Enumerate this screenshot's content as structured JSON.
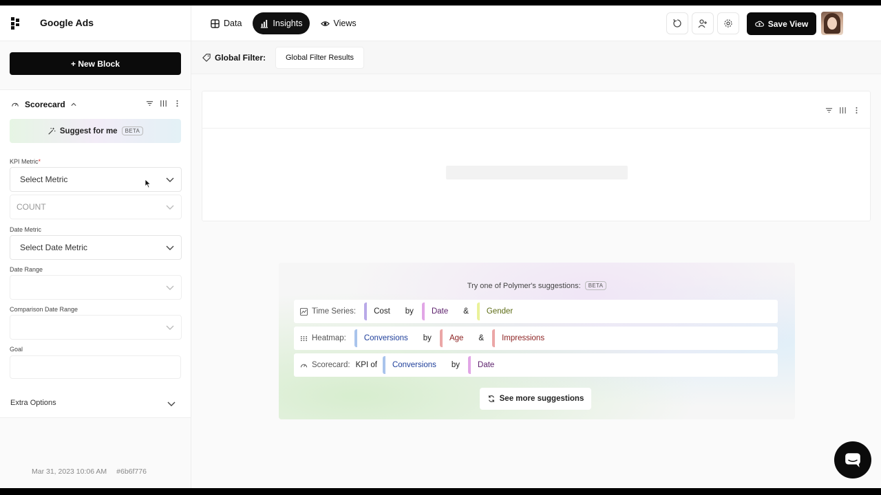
{
  "app": {
    "title": "Google Ads"
  },
  "nav": {
    "tabs": [
      {
        "label": "Data",
        "icon": "grid-icon",
        "active": false
      },
      {
        "label": "Insights",
        "icon": "bar-chart-icon",
        "active": true
      },
      {
        "label": "Views",
        "icon": "eye-icon",
        "active": false
      }
    ]
  },
  "toolbar": {
    "refresh_icon": "refresh-icon",
    "add_user_icon": "add-user-icon",
    "settings_icon": "gear-icon",
    "save_label": "Save View"
  },
  "sidebar": {
    "new_block_label": "+ New Block",
    "block": {
      "title": "Scorecard",
      "suggest_label": "Suggest for me",
      "beta": "BETA",
      "kpi_label": "KPI Metric",
      "kpi_placeholder": "Select Metric",
      "aggregate_value": "COUNT",
      "date_metric_label": "Date Metric",
      "date_metric_placeholder": "Select Date Metric",
      "date_range_label": "Date Range",
      "comparison_label": "Comparison Date Range",
      "goal_label": "Goal",
      "goal_value": "",
      "extra_label": "Extra Options"
    },
    "footer": {
      "timestamp": "Mar 31, 2023 10:06 AM",
      "hash": "#6b6f776"
    }
  },
  "filter": {
    "label": "Global Filter:",
    "result": "Global Filter Results"
  },
  "suggestions": {
    "title": "Try one of Polymer's suggestions:",
    "beta": "BETA",
    "rows": [
      {
        "kind": "Time Series:",
        "icon": "line-chart-icon",
        "metric": "Cost",
        "by": "by",
        "dim1": "Date",
        "amp": "&",
        "dim2": "Gender"
      },
      {
        "kind": "Heatmap:",
        "icon": "heatmap-icon",
        "metric": "Conversions",
        "by": "by",
        "dim1": "Age",
        "amp": "&",
        "dim2": "Impressions"
      },
      {
        "kind": "Scorecard:",
        "icon": "gauge-icon",
        "prefix": "KPI of",
        "metric": "Conversions",
        "by": "by",
        "dim1": "Date"
      }
    ],
    "see_more": "See more suggestions"
  },
  "colors": {
    "accent": "#0b0b0b",
    "chip_purple": "#b9a9e8",
    "chip_pink": "#e1a6e6",
    "chip_yellow": "#eaf29a",
    "chip_blue": "#a9c4ec",
    "chip_red": "#eba6a6"
  }
}
